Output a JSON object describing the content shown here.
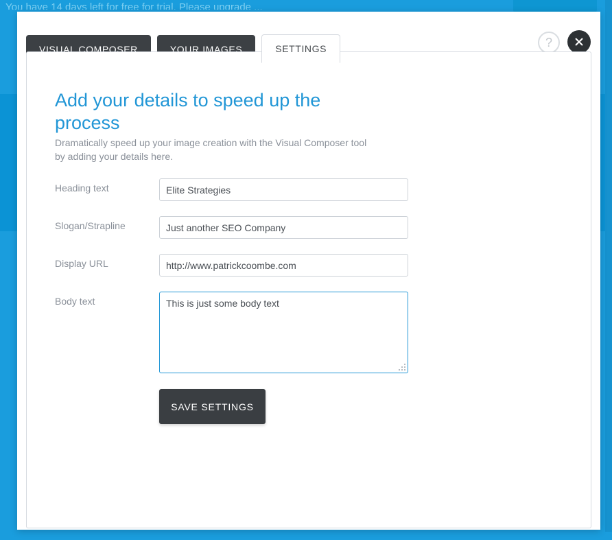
{
  "background": {
    "banner_text": "You have 14 days left for free for trial. Please upgrade ...",
    "cta_label": "",
    "accent_color": "#1a9ddd",
    "band_color": "#0b93d5"
  },
  "modal": {
    "tabs": [
      {
        "label": "VISUAL COMPOSER",
        "active": false
      },
      {
        "label": "YOUR IMAGES",
        "active": false
      },
      {
        "label": "SETTINGS",
        "active": true
      }
    ],
    "help_icon": "?",
    "close_icon": "close-icon"
  },
  "settings": {
    "title": "Add your details to speed up the process",
    "description": "Dramatically speed up your image creation with the Visual Composer tool by adding your details here.",
    "title_color": "#2196d6",
    "fields": [
      {
        "label": "Heading text",
        "value": "Elite Strategies",
        "placeholder": "",
        "type": "text"
      },
      {
        "label": "Slogan/Strapline",
        "value": "Just another SEO Company",
        "placeholder": "",
        "type": "text"
      },
      {
        "label": "Display URL",
        "value": "http://www.patrickcoombe.com",
        "placeholder": "",
        "type": "text"
      },
      {
        "label": "Body text",
        "value": "This is just some body text",
        "placeholder": "",
        "type": "textarea"
      }
    ],
    "save_label": "SAVE SETTINGS"
  }
}
